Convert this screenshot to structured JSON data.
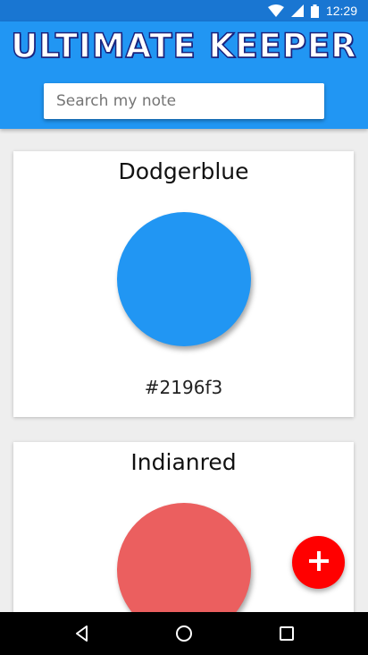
{
  "status_bar": {
    "time": "12:29",
    "icons": [
      "wifi-icon",
      "signal-icon",
      "battery-icon"
    ]
  },
  "header": {
    "title": "ULTIMATE KEEPER",
    "search_placeholder": "Search my note",
    "background_color": "#2196f3"
  },
  "notes": [
    {
      "name": "Dodgerblue",
      "hex": "#2196f3",
      "swatch_color": "#2196f3"
    },
    {
      "name": "Indianred",
      "hex": "",
      "swatch_color": "#eb5f5f"
    }
  ],
  "fab": {
    "icon": "plus-icon",
    "color": "#ff0000"
  },
  "nav_bar": {
    "icons": [
      "back-icon",
      "home-icon",
      "recent-apps-icon"
    ]
  }
}
